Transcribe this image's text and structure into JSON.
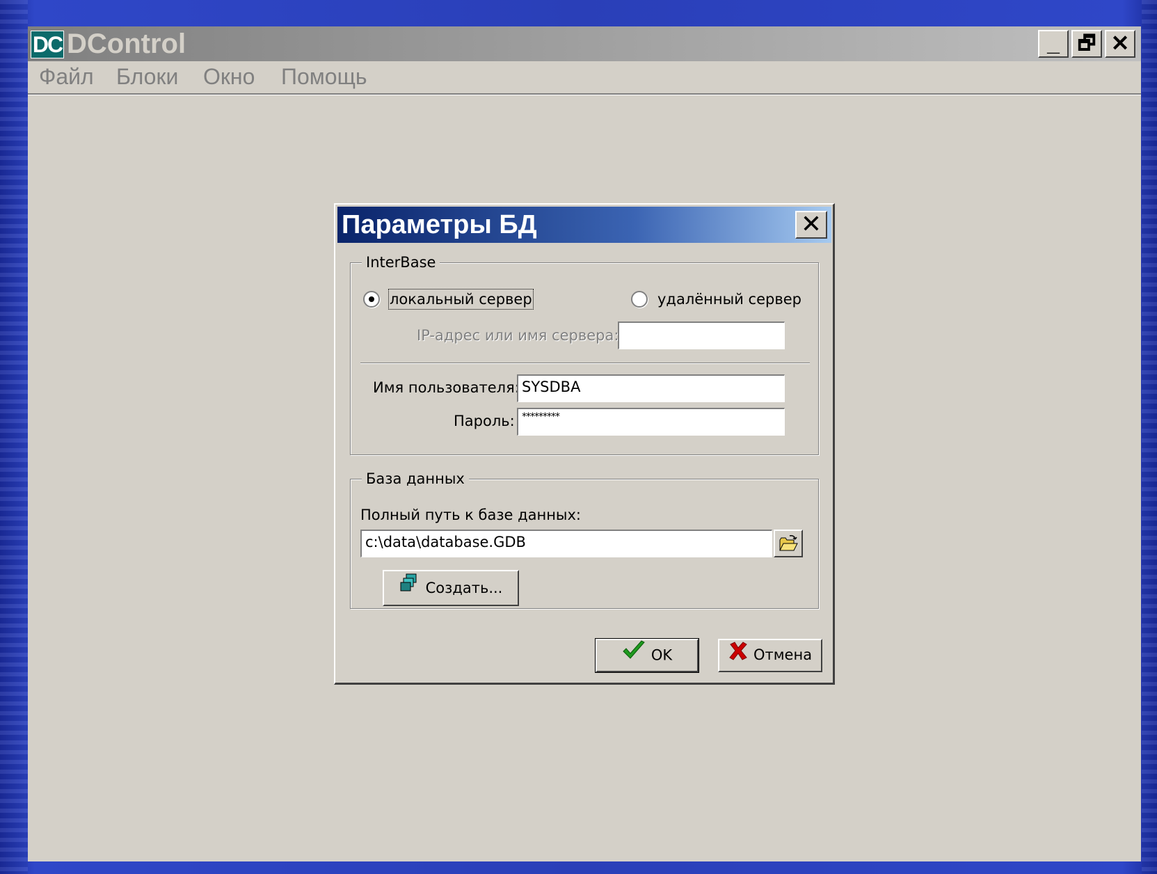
{
  "app": {
    "logo_text": "DC",
    "title": "DControl",
    "window_buttons": {
      "minimize": "_",
      "restore": "🗗",
      "close": "✕"
    }
  },
  "menu": [
    "Файл",
    "Блоки",
    "Окно",
    "Помощь"
  ],
  "dialog": {
    "title": "Параметры БД",
    "close": "✕",
    "interbase": {
      "legend": "InterBase",
      "local_label": "локальный сервер",
      "remote_label": "удалённый сервер",
      "selected": "local",
      "ip_label": "IP-адрес или имя сервера:",
      "ip_value": "",
      "user_label": "Имя пользователя:",
      "user_value": "SYSDBA",
      "password_label": "Пароль:",
      "password_value": "*********"
    },
    "database": {
      "legend": "База данных",
      "path_label": "Полный путь к базе данных:",
      "path_value": "c:\\data\\database.GDB",
      "browse_icon": "open-folder-icon",
      "create_label": "Создать..."
    },
    "ok_label": "OK",
    "cancel_label": "Отмена"
  },
  "colors": {
    "titlebar_active_start": "#0a246a",
    "titlebar_active_end": "#a6caf0",
    "face": "#d4d0c8",
    "ok_check": "#1f9a1f",
    "cancel_x": "#cc0000"
  }
}
